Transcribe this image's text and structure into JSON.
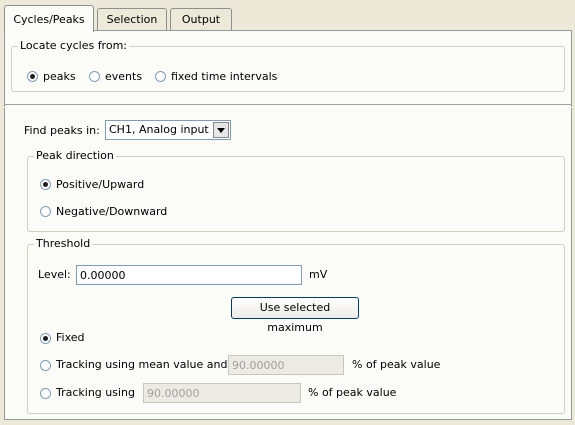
{
  "tabs": [
    {
      "label": "Cycles/Peaks"
    },
    {
      "label": "Selection"
    },
    {
      "label": "Output"
    }
  ],
  "locate": {
    "legend": "Locate cycles from:",
    "options": [
      {
        "label": "peaks",
        "selected": true
      },
      {
        "label": "events",
        "selected": false
      },
      {
        "label": "fixed time intervals",
        "selected": false
      }
    ]
  },
  "find_peaks": {
    "label": "Find peaks in:",
    "selected": "CH1, Analog input"
  },
  "peak_direction": {
    "legend": "Peak direction",
    "options": [
      {
        "label": "Positive/Upward",
        "selected": true
      },
      {
        "label": "Negative/Downward",
        "selected": false
      }
    ]
  },
  "threshold": {
    "legend": "Threshold",
    "level_label": "Level:",
    "level_value": "0.00000",
    "level_unit": "mV",
    "use_max_button": "Use selected maximum",
    "fixed_label": "Fixed",
    "tracking_mean_label": "Tracking using mean value and",
    "tracking_mean_value": "90.00000",
    "tracking_mean_unit": "% of peak value",
    "tracking_label": "Tracking using",
    "tracking_value": "90.00000",
    "tracking_unit": "% of peak value",
    "selected": "Fixed"
  }
}
